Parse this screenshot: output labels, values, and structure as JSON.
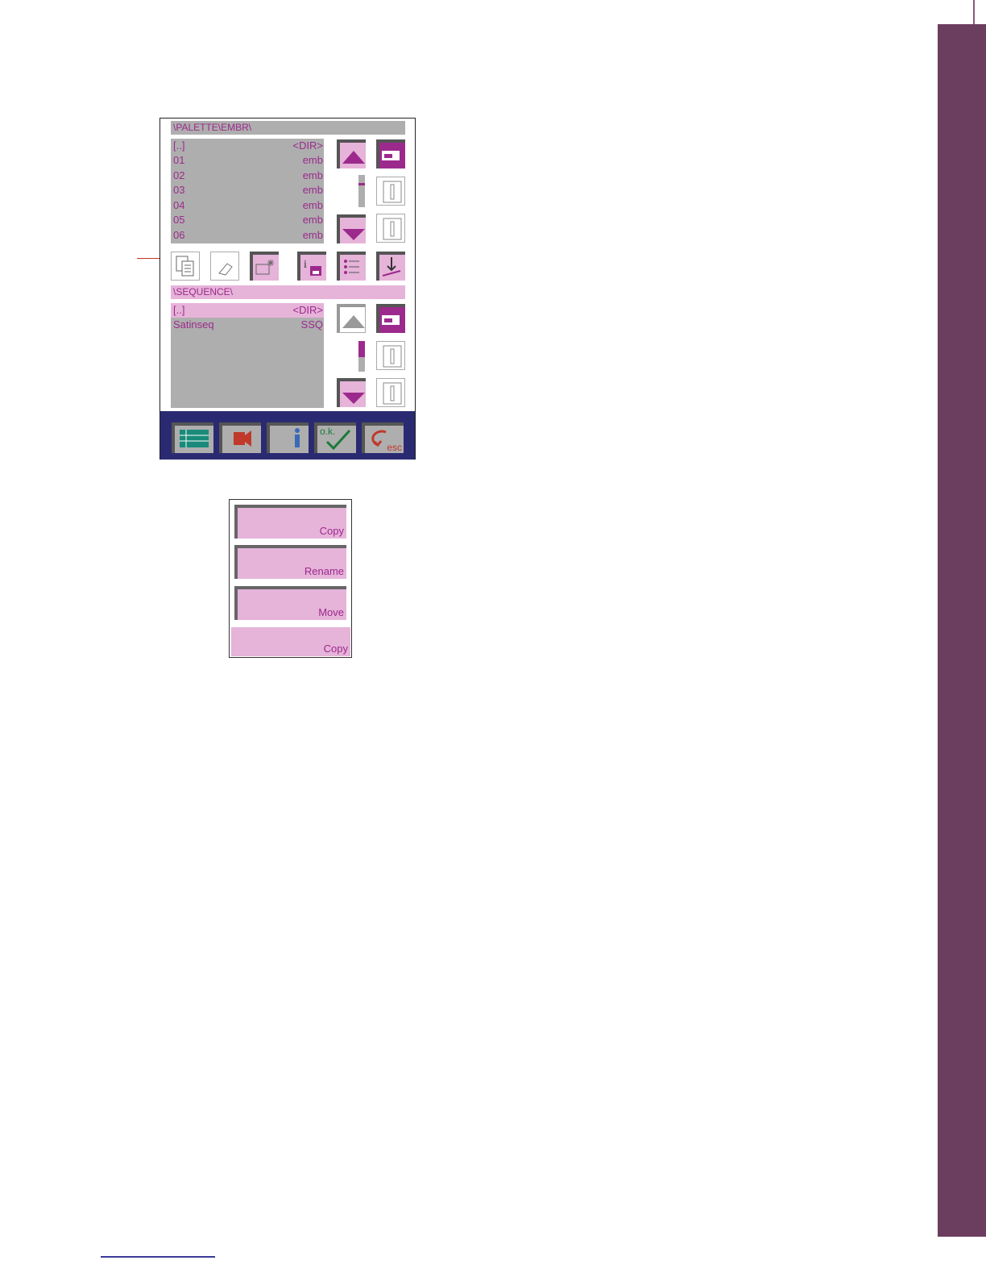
{
  "top_panel": {
    "path": "\\PALETTE\\EMBR\\",
    "rows": [
      {
        "name": "[..]",
        "type": "<DIR>"
      },
      {
        "name": "01",
        "type": "emb"
      },
      {
        "name": "02",
        "type": "emb"
      },
      {
        "name": "03",
        "type": "emb"
      },
      {
        "name": "04",
        "type": "emb"
      },
      {
        "name": "05",
        "type": "emb"
      },
      {
        "name": "06",
        "type": "emb"
      }
    ]
  },
  "bottom_panel": {
    "path": "\\SEQUENCE\\",
    "rows": [
      {
        "name": "[..]",
        "type": "<DIR>"
      },
      {
        "name": "Satinseq",
        "type": "SSQ"
      }
    ]
  },
  "taskbar": {
    "ok_label": "o.k.",
    "esc_label": "esc"
  },
  "menu": {
    "copy_label": "Copy",
    "rename_label": "Rename",
    "move_label": "Move",
    "copy2_label": "Copy"
  },
  "colors": {
    "accent": "#9c2a8c",
    "pink": "#e6b3d9",
    "taskbar": "#2a2a72",
    "side_bar": "#6b3d5e"
  },
  "icons": [
    "copy-icon",
    "erase-icon",
    "new-folder-icon",
    "info-disk-icon",
    "list-icon",
    "download-icon",
    "sewing-machine-icon",
    "spool-icon",
    "list-view-icon",
    "film-icon",
    "info-icon",
    "ok-check-icon",
    "esc-icon"
  ]
}
